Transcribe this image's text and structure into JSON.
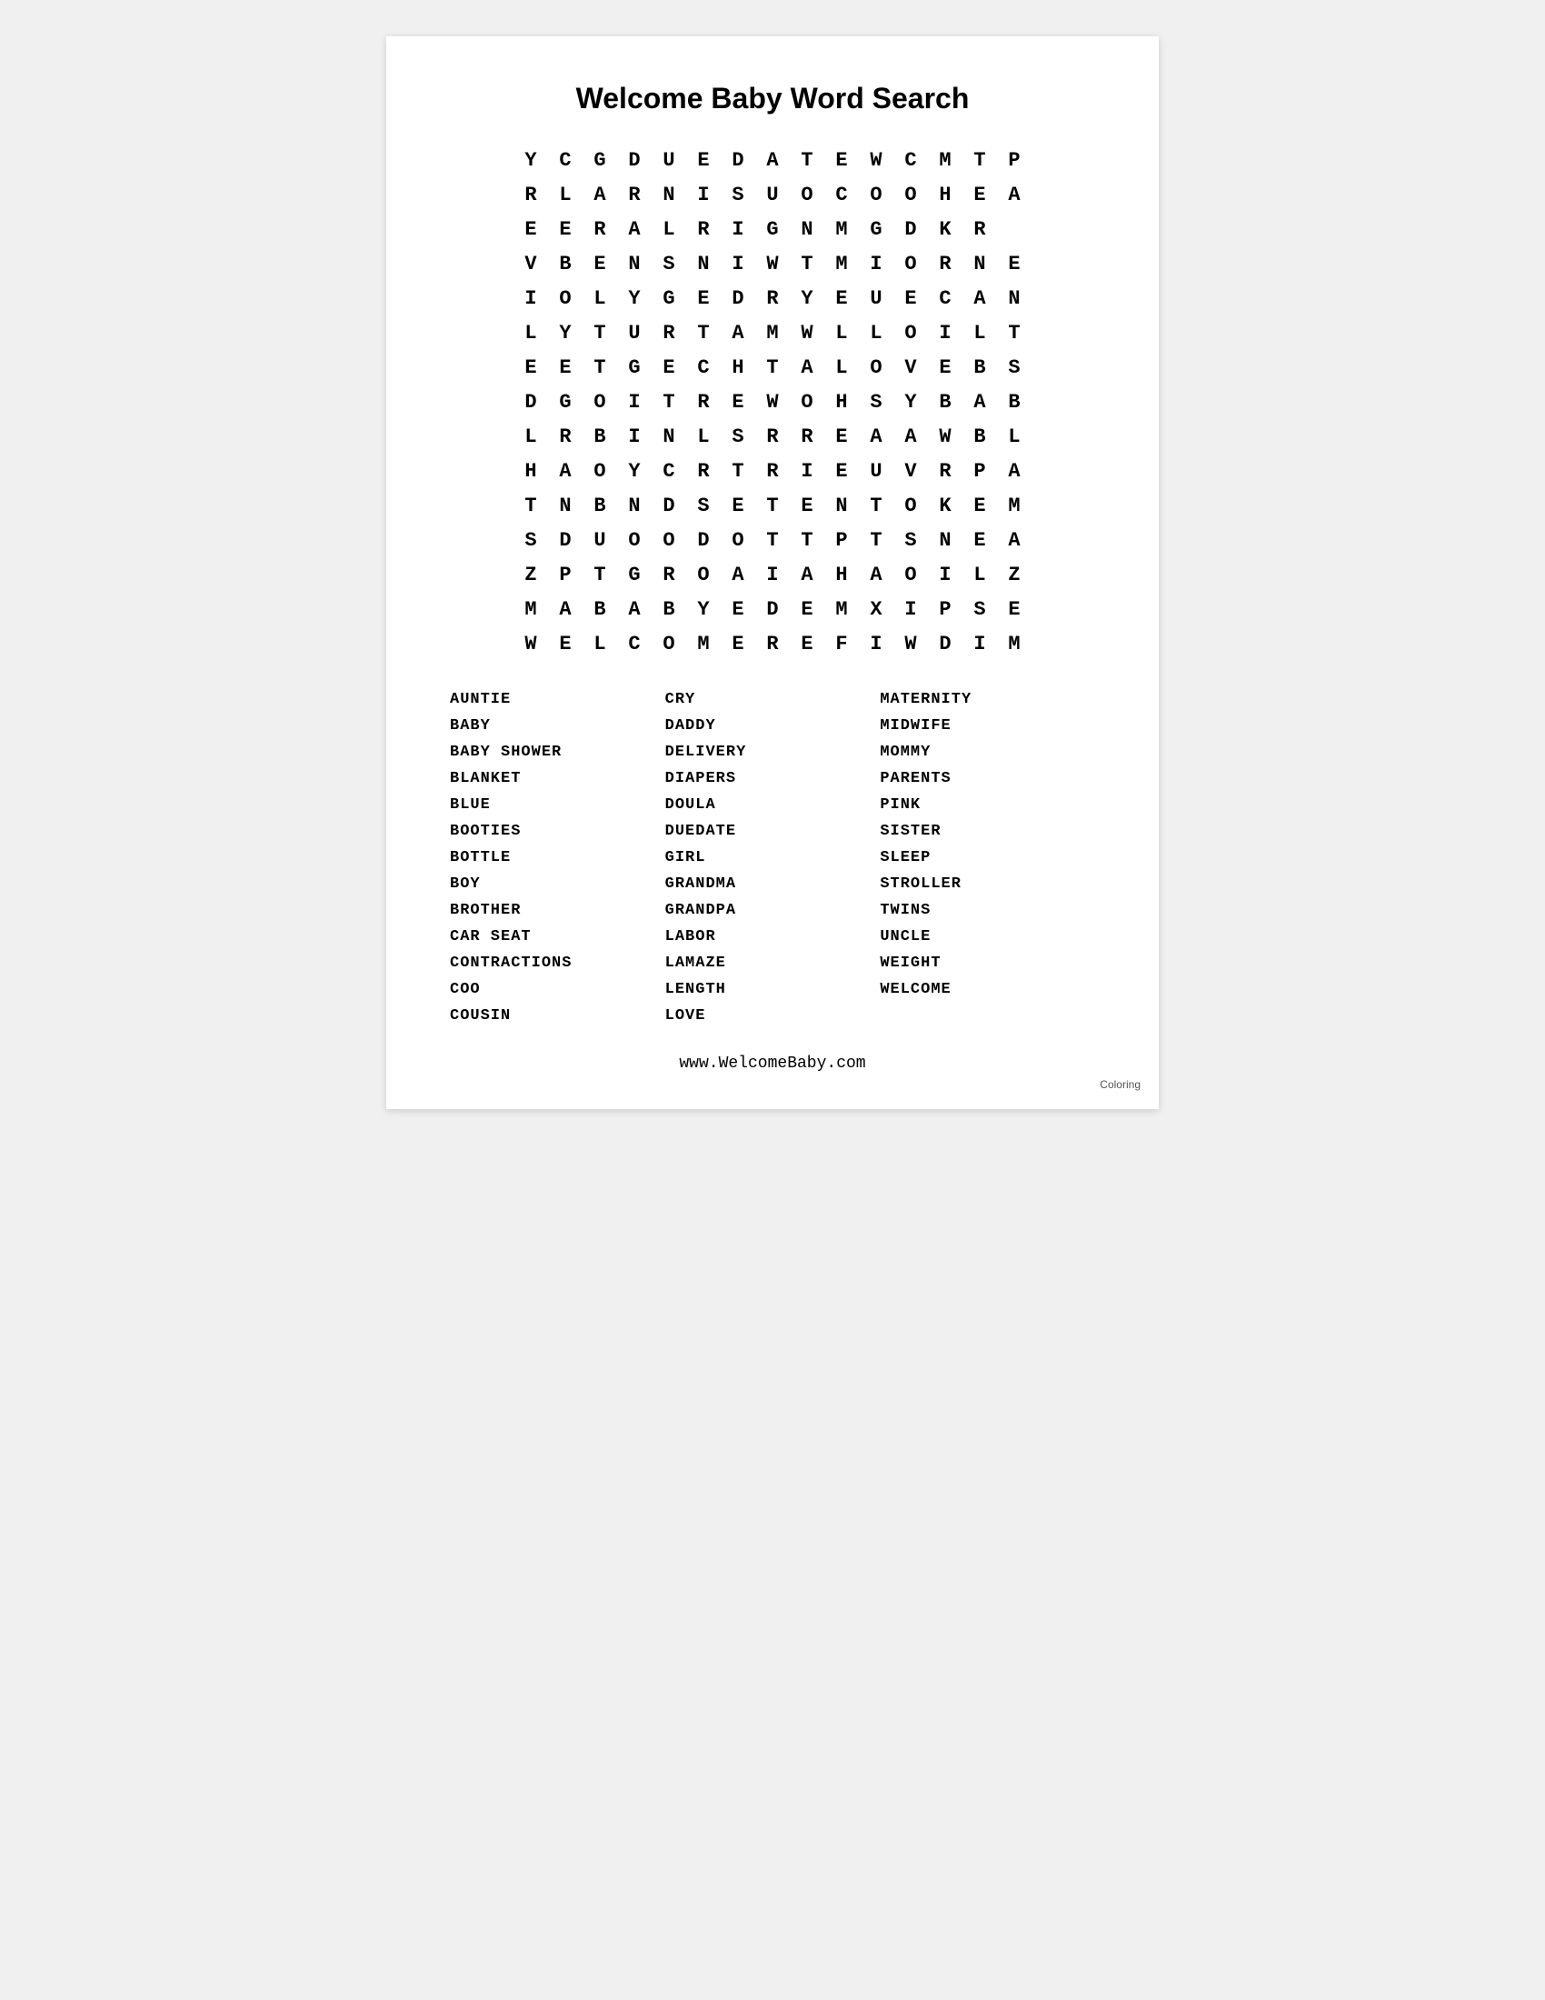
{
  "page": {
    "title": "Welcome Baby Word Search",
    "url": "www.WelcomeBaby.com",
    "coloring_label": "Coloring"
  },
  "grid": {
    "rows": [
      [
        "Y",
        "C",
        "G",
        "D",
        "U",
        "E",
        "D",
        "A",
        "T",
        "E",
        "W",
        "C",
        "M",
        "T",
        "P"
      ],
      [
        "R",
        "L",
        "A",
        "R",
        "N",
        "I",
        "S",
        "U",
        "O",
        "C",
        "O",
        "O",
        "H",
        "E",
        "A"
      ],
      [
        "E",
        "E",
        "R",
        "A",
        "L",
        "R",
        "I",
        "G",
        "N",
        "M",
        "G",
        "D",
        "K",
        "R",
        ""
      ],
      [
        "V",
        "B",
        "E",
        "N",
        "S",
        "N",
        "I",
        "W",
        "T",
        "M",
        "I",
        "O",
        "R",
        "N",
        "E"
      ],
      [
        "I",
        "O",
        "L",
        "Y",
        "G",
        "E",
        "D",
        "R",
        "Y",
        "E",
        "U",
        "E",
        "C",
        "A",
        "N"
      ],
      [
        "L",
        "Y",
        "T",
        "U",
        "R",
        "T",
        "A",
        "M",
        "W",
        "L",
        "L",
        "O",
        "I",
        "L",
        "T"
      ],
      [
        "E",
        "E",
        "T",
        "G",
        "E",
        "C",
        "H",
        "T",
        "A",
        "L",
        "O",
        "V",
        "E",
        "B",
        "S"
      ],
      [
        "D",
        "G",
        "O",
        "I",
        "T",
        "R",
        "E",
        "W",
        "O",
        "H",
        "S",
        "Y",
        "B",
        "A",
        "B"
      ],
      [
        "L",
        "R",
        "B",
        "I",
        "N",
        "L",
        "S",
        "R",
        "R",
        "E",
        "A",
        "A",
        "W",
        "B",
        "L"
      ],
      [
        "H",
        "A",
        "O",
        "Y",
        "C",
        "R",
        "T",
        "R",
        "I",
        "E",
        "U",
        "V",
        "R",
        "P",
        "A"
      ],
      [
        "T",
        "N",
        "B",
        "N",
        "D",
        "S",
        "E",
        "T",
        "E",
        "N",
        "T",
        "O",
        "K",
        "E",
        "M"
      ],
      [
        "S",
        "D",
        "U",
        "O",
        "O",
        "D",
        "O",
        "T",
        "T",
        "P",
        "T",
        "S",
        "N",
        "E",
        "A"
      ],
      [
        "Z",
        "P",
        "T",
        "G",
        "R",
        "O",
        "A",
        "I",
        "A",
        "H",
        "A",
        "O",
        "I",
        "L",
        "Z"
      ],
      [
        "M",
        "A",
        "B",
        "A",
        "B",
        "Y",
        "E",
        "D",
        "E",
        "M",
        "X",
        "I",
        "P",
        "S",
        "E"
      ],
      [
        "W",
        "E",
        "L",
        "C",
        "O",
        "M",
        "E",
        "R",
        "E",
        "F",
        "I",
        "W",
        "D",
        "I",
        "M"
      ]
    ]
  },
  "word_list": {
    "col1": [
      "AUNTIE",
      "BABY",
      "BABY SHOWER",
      "BLANKET",
      "BLUE",
      "BOOTIES",
      "BOTTLE",
      "BOY",
      "BROTHER",
      "CAR SEAT",
      "CONTRACTIONS",
      "COO",
      "COUSIN"
    ],
    "col2": [
      "CRY",
      "DADDY",
      "DELIVERY",
      "DIAPERS",
      "DOULA",
      "DUEDATE",
      "GIRL",
      "GRANDMA",
      "GRANDPA",
      "LABOR",
      "LAMAZE",
      "LENGTH",
      "LOVE"
    ],
    "col3": [
      "MATERNITY",
      "MIDWIFE",
      "MOMMY",
      "PARENTS",
      "PINK",
      "SISTER",
      "SLEEP",
      "STROLLER",
      "TWINS",
      "UNCLE",
      "WEIGHT",
      "WELCOME",
      ""
    ]
  }
}
